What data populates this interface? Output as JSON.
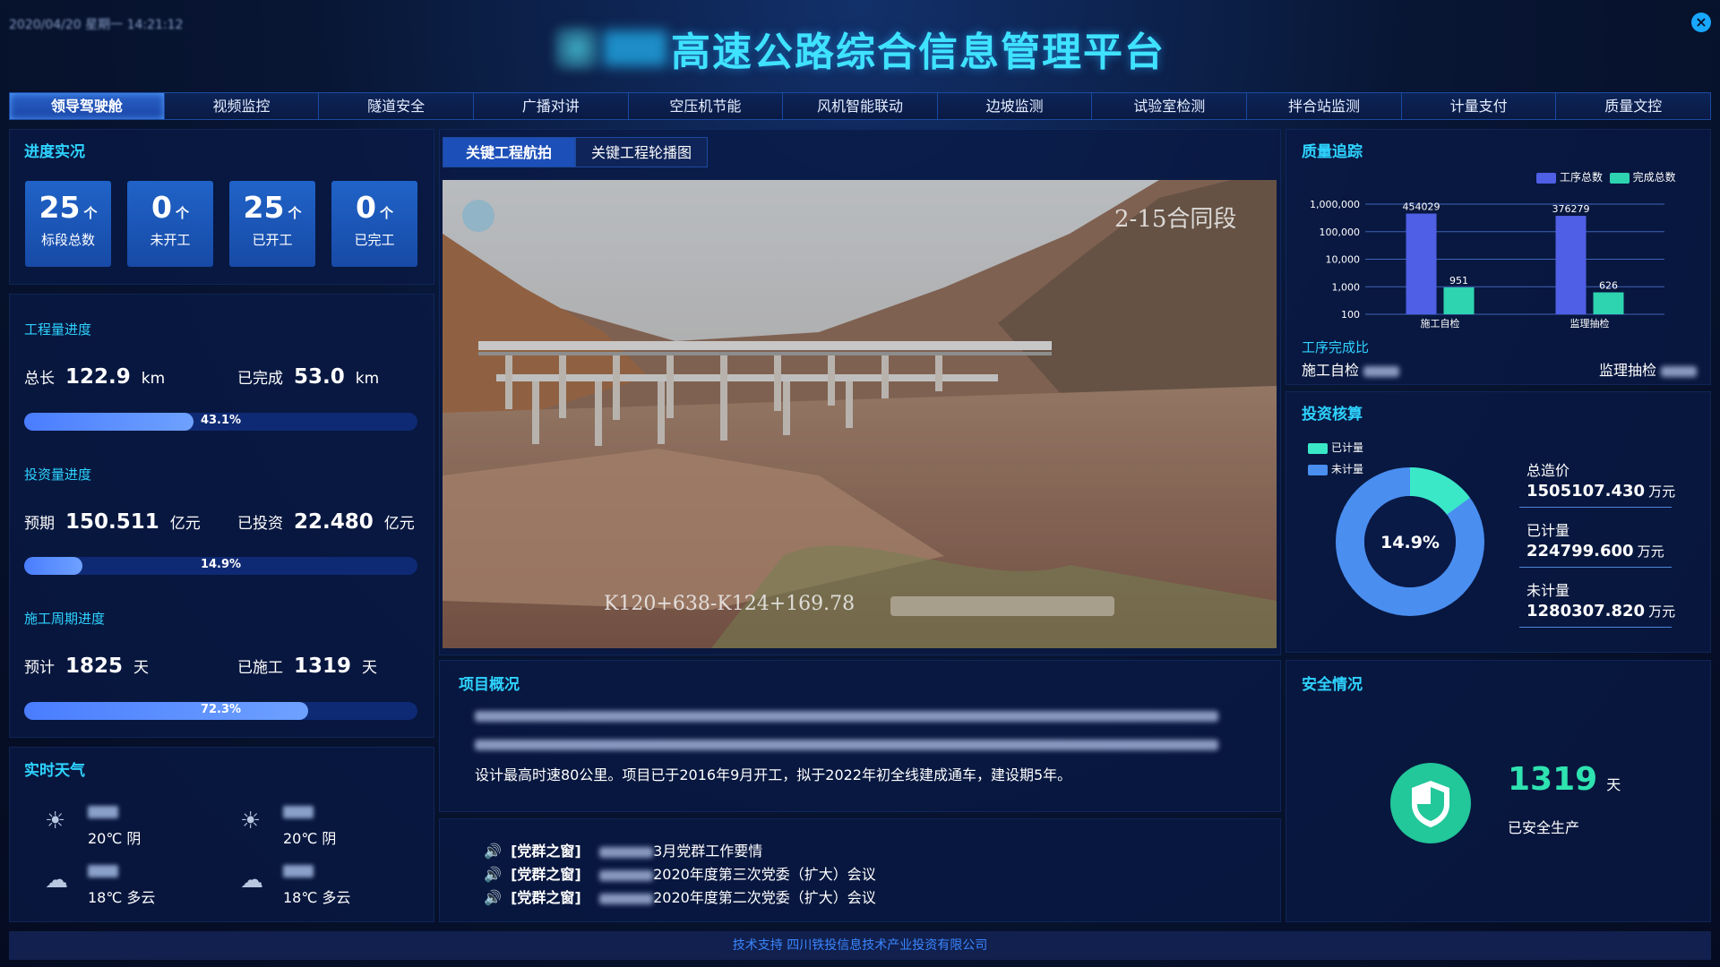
{
  "header": {
    "datetime": "2020/04/20 星期一 14:21:12",
    "title": "高速公路综合信息管理平台",
    "close_label": "×"
  },
  "nav": {
    "items": [
      "领导驾驶舱",
      "视频监控",
      "隧道安全",
      "广播对讲",
      "空压机节能",
      "风机智能联动",
      "边坡监测",
      "试验室检测",
      "拌合站监测",
      "计量支付",
      "质量文控"
    ],
    "active_index": 0
  },
  "progress": {
    "title": "进度实况",
    "cards": [
      {
        "value": "25",
        "unit": "个",
        "label": "标段总数"
      },
      {
        "value": "0",
        "unit": "个",
        "label": "未开工"
      },
      {
        "value": "25",
        "unit": "个",
        "label": "已开工"
      },
      {
        "value": "0",
        "unit": "个",
        "label": "已完工"
      }
    ],
    "workload": {
      "title": "工程量进度",
      "total_label": "总长",
      "total_value": "122.9",
      "total_unit": "km",
      "done_label": "已完成",
      "done_value": "53.0",
      "done_unit": "km",
      "percent_text": "43.1%",
      "percent": 43.1
    },
    "investment": {
      "title": "投资量进度",
      "total_label": "预期",
      "total_value": "150.511",
      "total_unit": "亿元",
      "done_label": "已投资",
      "done_value": "22.480",
      "done_unit": "亿元",
      "percent_text": "14.9%",
      "percent": 14.9
    },
    "period": {
      "title": "施工周期进度",
      "total_label": "预计",
      "total_value": "1825",
      "total_unit": "天",
      "done_label": "已施工",
      "done_value": "1319",
      "done_unit": "天",
      "percent_text": "72.3%",
      "percent": 72.3
    }
  },
  "weather": {
    "title": "实时天气",
    "items": [
      {
        "icon": "sun-cloud-icon",
        "temp": "20℃ 阴"
      },
      {
        "icon": "sun-cloud-icon",
        "temp": "20℃ 阴"
      },
      {
        "icon": "cloud-icon",
        "temp": "18℃ 多云"
      },
      {
        "icon": "cloud-icon",
        "temp": "18℃ 多云"
      }
    ]
  },
  "center": {
    "tabs": [
      "关键工程航拍",
      "关键工程轮播图"
    ],
    "active_tab": 0,
    "photo_label_top": "2-15合同段",
    "photo_label_bottom": "K120+638-K124+169.78"
  },
  "overview": {
    "title": "项目概况",
    "visible_line": "设计最高时速80公里。项目已于2016年9月开工，拟于2022年初全线建成通车，建设期5年。"
  },
  "notices": [
    {
      "tag": "[党群之窗]",
      "text": "3月党群工作要情"
    },
    {
      "tag": "[党群之窗]",
      "text": "2020年度第三次党委（扩大）会议"
    },
    {
      "tag": "[党群之窗]",
      "text": "2020年度第二次党委（扩大）会议"
    }
  ],
  "quality": {
    "title": "质量追踪",
    "legend": [
      "工序总数",
      "完成总数"
    ],
    "ratio_title": "工序完成比",
    "ratio_items": [
      "施工自检",
      "监理抽检"
    ]
  },
  "chart_data": {
    "type": "bar",
    "categories": [
      "施工自检",
      "监理抽检"
    ],
    "series": [
      {
        "name": "工序总数",
        "values": [
          454029,
          376279
        ],
        "color": "#4f5fe6"
      },
      {
        "name": "完成总数",
        "values": [
          951,
          626
        ],
        "color": "#2ed3b0"
      }
    ],
    "yscale": "log",
    "yticks": [
      "1,000,000",
      "100,000",
      "10,000",
      "1,000",
      "100"
    ],
    "ylim": [
      100,
      1000000
    ],
    "legend": "top-right"
  },
  "investment_check": {
    "title": "投资核算",
    "legend": [
      "已计量",
      "未计量"
    ],
    "center_text": "14.9%",
    "measured_fraction": 0.149,
    "colors": {
      "measured": "#3ae8c8",
      "unmeasured": "#4a8ef0"
    },
    "items": [
      {
        "label": "总造价",
        "value": "1505107.430",
        "unit": "万元"
      },
      {
        "label": "已计量",
        "value": "224799.600",
        "unit": "万元"
      },
      {
        "label": "未计量",
        "value": "1280307.820",
        "unit": "万元"
      }
    ]
  },
  "safety": {
    "title": "安全情况",
    "days": "1319",
    "unit": "天",
    "label": "已安全生产"
  },
  "footer": {
    "text": "技术支持 四川铁投信息技术产业投资有限公司"
  }
}
